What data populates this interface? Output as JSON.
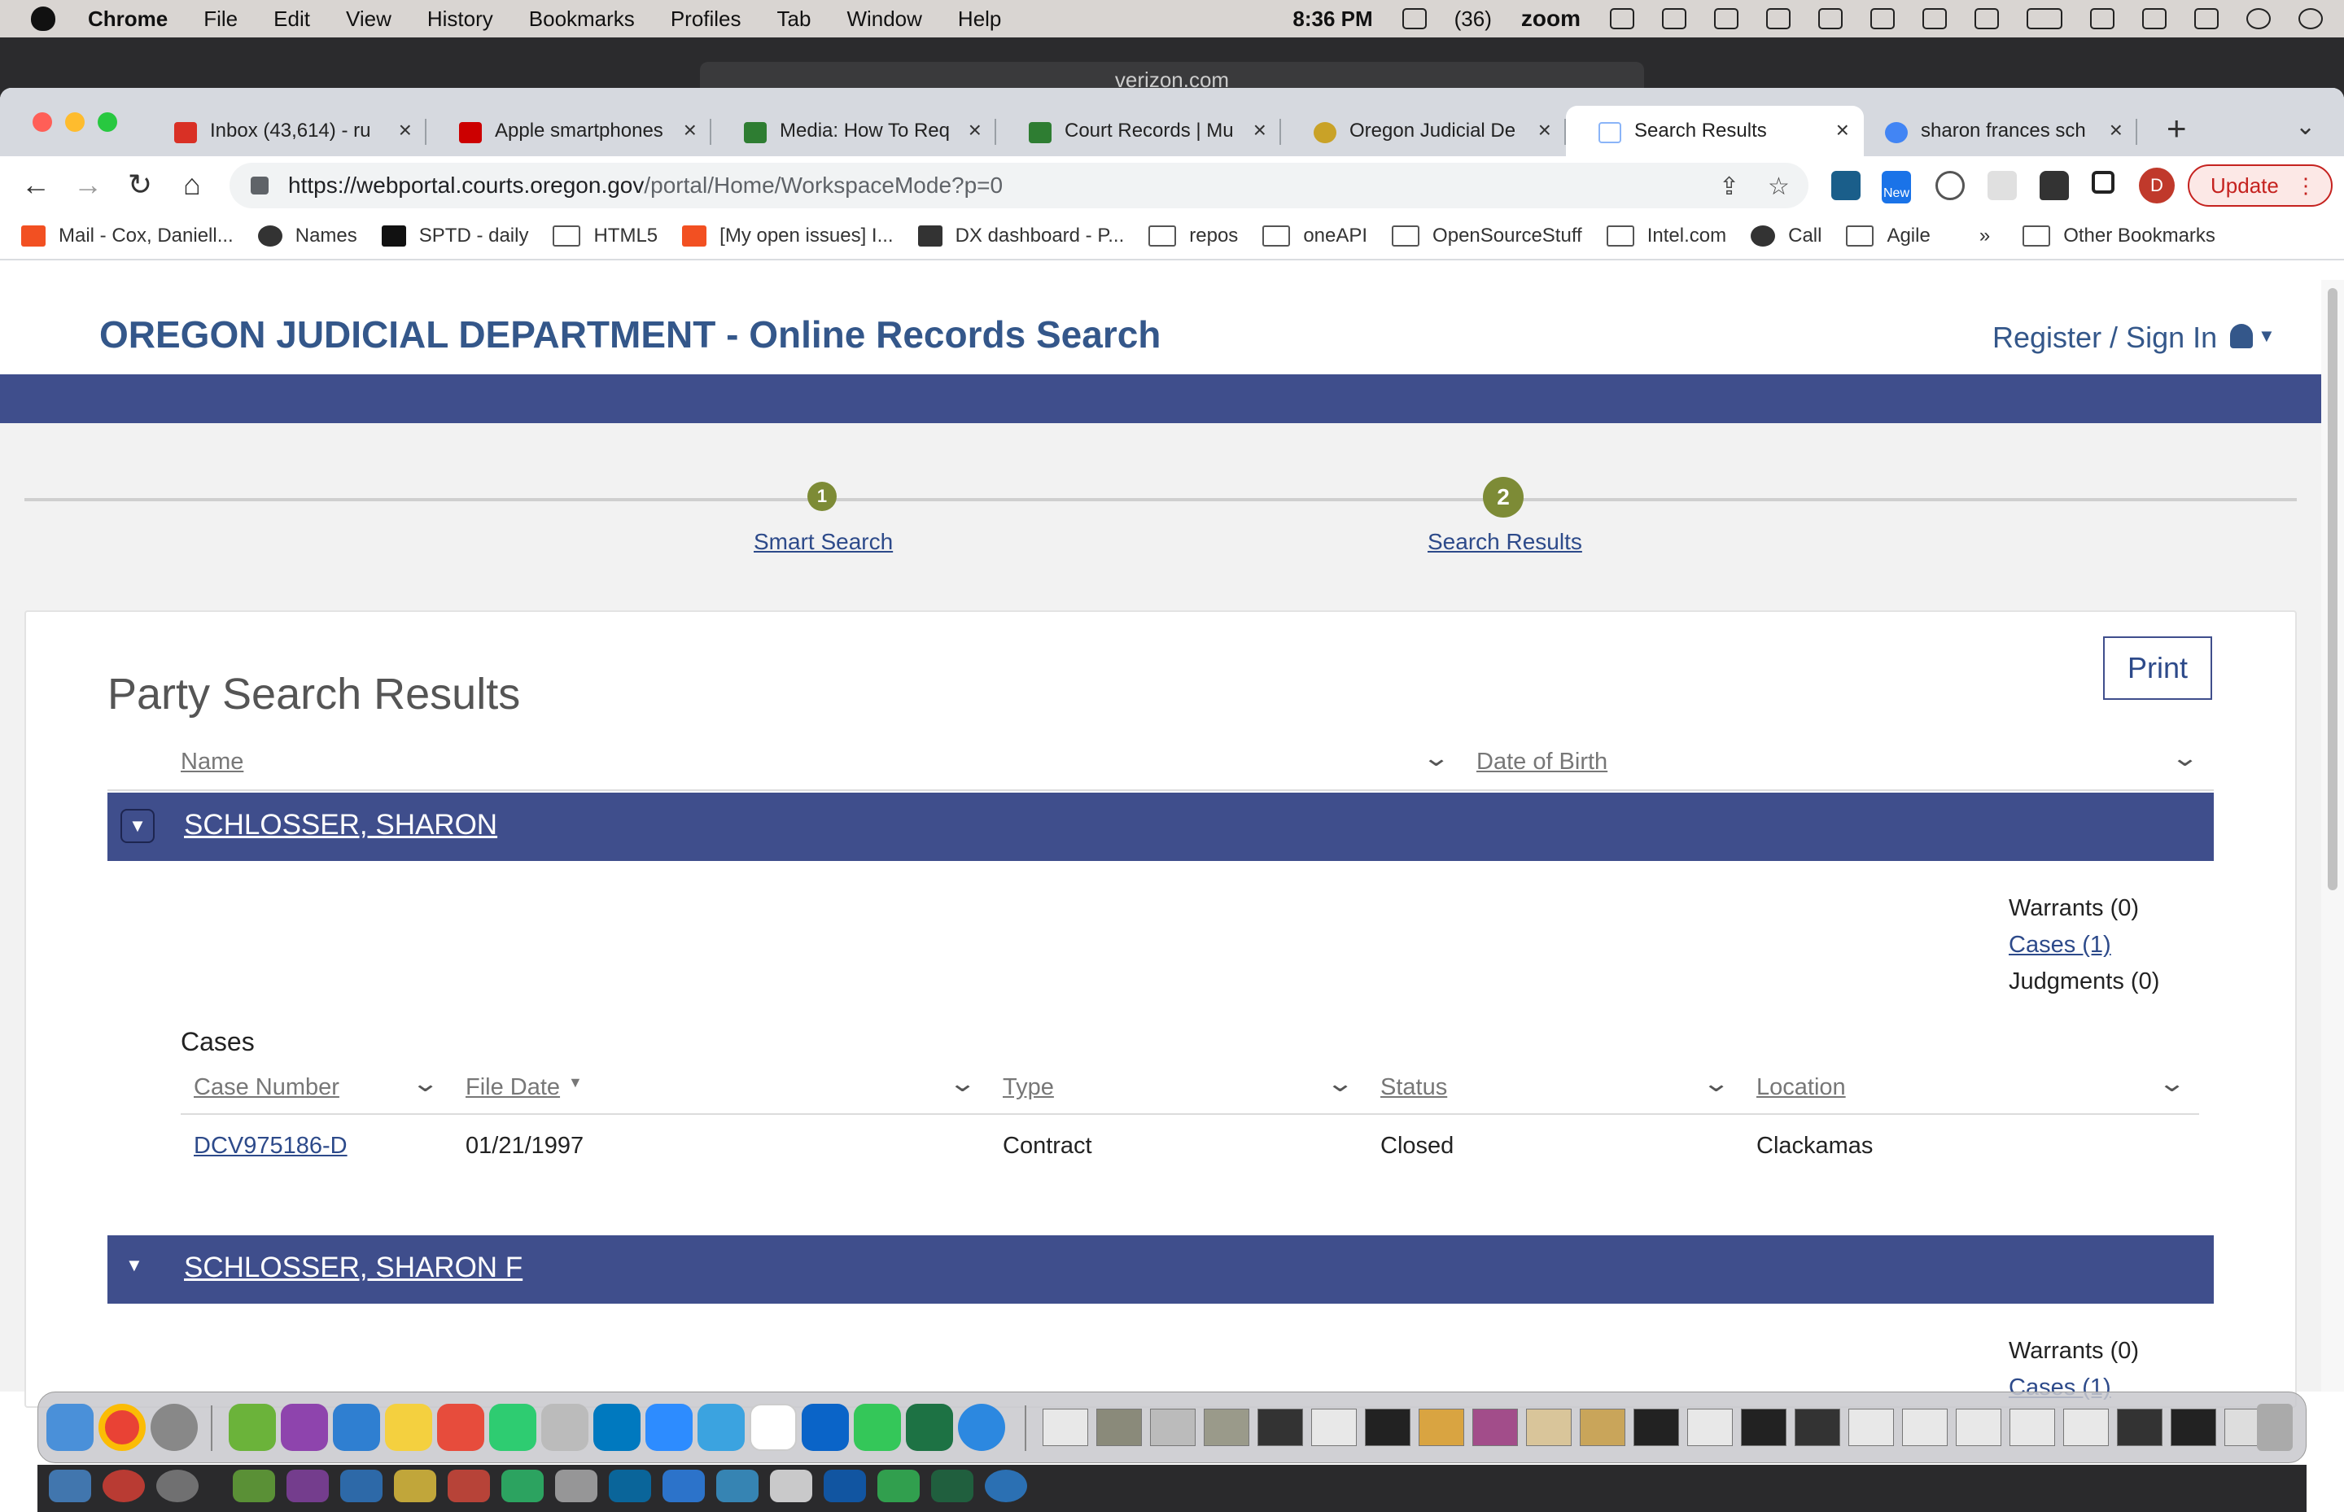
{
  "menubar": {
    "app": "Chrome",
    "items": [
      "File",
      "Edit",
      "View",
      "History",
      "Bookmarks",
      "Profiles",
      "Tab",
      "Window",
      "Help"
    ],
    "time": "8:36 PM",
    "calendar_badge": "(36)",
    "zoom": "zoom"
  },
  "bg_window": {
    "url": "verizon.com"
  },
  "tabs": [
    {
      "label": "Inbox (43,614) - ru",
      "icon_color": "#d93025"
    },
    {
      "label": "Apple smartphones",
      "icon_color": "#cc0000"
    },
    {
      "label": "Media: How To Req",
      "icon_color": "#2e7d32"
    },
    {
      "label": "Court Records | Mu",
      "icon_color": "#2e7d32"
    },
    {
      "label": "Oregon Judicial De",
      "icon_color": "#c9a227"
    },
    {
      "label": "Search Results",
      "icon_color": "#8ab4f8"
    },
    {
      "label": "sharon frances sch",
      "icon_color": "#4285f4"
    }
  ],
  "toolbar": {
    "url_host": "https://webportal.courts.oregon.gov",
    "url_path": "/portal/Home/WorkspaceMode?p=0",
    "ext_badge": "New",
    "avatar": "D",
    "update_label": "Update"
  },
  "bookmarks": {
    "items": [
      "Mail - Cox, Daniell...",
      "Names",
      "SPTD - daily",
      "HTML5",
      "[My open issues] I...",
      "DX dashboard - P...",
      "repos",
      "oneAPI",
      "OpenSourceStuff",
      "Intel.com",
      "Call",
      "Agile"
    ],
    "overflow": "»",
    "other": "Other Bookmarks"
  },
  "portal": {
    "title": "OREGON JUDICIAL DEPARTMENT - Online Records Search",
    "signin": "Register / Sign In",
    "steps": [
      {
        "num": "1",
        "label": "Smart Search"
      },
      {
        "num": "2",
        "label": "Search Results"
      }
    ],
    "print": "Print",
    "heading": "Party Search Results",
    "col_name": "Name",
    "col_dob": "Date of Birth",
    "parties": [
      {
        "name": "SCHLOSSER, SHARON",
        "warrants": "Warrants (0)",
        "cases": "Cases (1)",
        "judgments": "Judgments (0)",
        "cases_heading": "Cases",
        "case_cols": [
          "Case Number",
          "File Date",
          "Type",
          "Status",
          "Location"
        ],
        "case_rows": [
          {
            "number": "DCV975186-D",
            "date": "01/21/1997",
            "type": "Contract",
            "status": "Closed",
            "location": "Clackamas"
          }
        ]
      },
      {
        "name": "SCHLOSSER, SHARON F",
        "warrants": "Warrants (0)",
        "cases": "Cases (1)"
      }
    ]
  }
}
